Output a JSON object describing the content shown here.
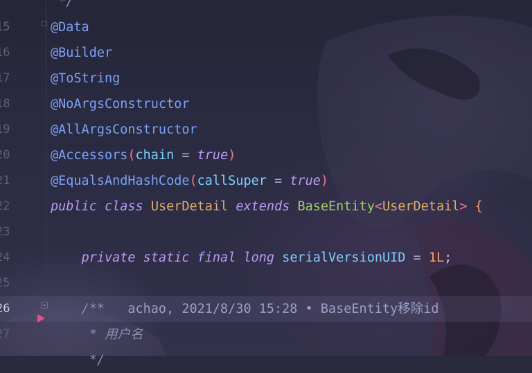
{
  "editor": {
    "lines": [
      {
        "number": "",
        "tokens": [
          {
            "t": " */",
            "c": "cm"
          }
        ]
      },
      {
        "number": "15",
        "tokens": [
          {
            "t": "@Data",
            "c": "ann"
          }
        ]
      },
      {
        "number": "16",
        "tokens": [
          {
            "t": "@Builder",
            "c": "ann"
          }
        ]
      },
      {
        "number": "17",
        "tokens": [
          {
            "t": "@ToString",
            "c": "ann"
          }
        ]
      },
      {
        "number": "18",
        "tokens": [
          {
            "t": "@NoArgsConstructor",
            "c": "ann"
          }
        ]
      },
      {
        "number": "19",
        "tokens": [
          {
            "t": "@AllArgsConstructor",
            "c": "ann"
          }
        ]
      },
      {
        "number": "20",
        "tokens": [
          {
            "t": "@Accessors",
            "c": "ann"
          },
          {
            "t": "(",
            "c": "paren"
          },
          {
            "t": "chain",
            "c": "param"
          },
          {
            "t": " = ",
            "c": "op"
          },
          {
            "t": "true",
            "c": "kw"
          },
          {
            "t": ")",
            "c": "paren"
          }
        ]
      },
      {
        "number": "21",
        "tokens": [
          {
            "t": "@EqualsAndHashCode",
            "c": "ann"
          },
          {
            "t": "(",
            "c": "paren"
          },
          {
            "t": "callSuper",
            "c": "param"
          },
          {
            "t": " = ",
            "c": "op"
          },
          {
            "t": "true",
            "c": "kw"
          },
          {
            "t": ")",
            "c": "paren"
          }
        ]
      },
      {
        "number": "22",
        "tokens": [
          {
            "t": "public",
            "c": "kw"
          },
          {
            "t": " ",
            "c": "op"
          },
          {
            "t": "class",
            "c": "kw"
          },
          {
            "t": " ",
            "c": "op"
          },
          {
            "t": "UserDetail",
            "c": "cls"
          },
          {
            "t": " ",
            "c": "op"
          },
          {
            "t": "extends",
            "c": "kw"
          },
          {
            "t": " ",
            "c": "op"
          },
          {
            "t": "BaseEntity",
            "c": "type"
          },
          {
            "t": "<",
            "c": "paren"
          },
          {
            "t": "UserDetail",
            "c": "cls"
          },
          {
            "t": ">",
            "c": "paren"
          },
          {
            "t": " {",
            "c": "brace"
          }
        ]
      },
      {
        "number": "23",
        "tokens": []
      },
      {
        "number": "24",
        "tokens": [
          {
            "t": "    ",
            "c": "op"
          },
          {
            "t": "private",
            "c": "kw"
          },
          {
            "t": " ",
            "c": "op"
          },
          {
            "t": "static",
            "c": "kw"
          },
          {
            "t": " ",
            "c": "op"
          },
          {
            "t": "final",
            "c": "kw"
          },
          {
            "t": " ",
            "c": "op"
          },
          {
            "t": "long",
            "c": "kw"
          },
          {
            "t": " ",
            "c": "op"
          },
          {
            "t": "serialVersionUID",
            "c": "field"
          },
          {
            "t": " = ",
            "c": "op"
          },
          {
            "t": "1L",
            "c": "num"
          },
          {
            "t": ";",
            "c": "punct"
          }
        ]
      },
      {
        "number": "25",
        "tokens": []
      },
      {
        "number": "26",
        "current": true,
        "tokens": [
          {
            "t": "    /**",
            "c": "cm"
          },
          {
            "t": "   achao, 2021/8/30 15:28 • BaseEntity移除id",
            "c": "blame"
          }
        ]
      },
      {
        "number": "27",
        "tokens": [
          {
            "t": "     * 用户名",
            "c": "cm"
          }
        ]
      },
      {
        "number": "",
        "tokens": [
          {
            "t": "     */",
            "c": "cm"
          }
        ]
      }
    ]
  }
}
